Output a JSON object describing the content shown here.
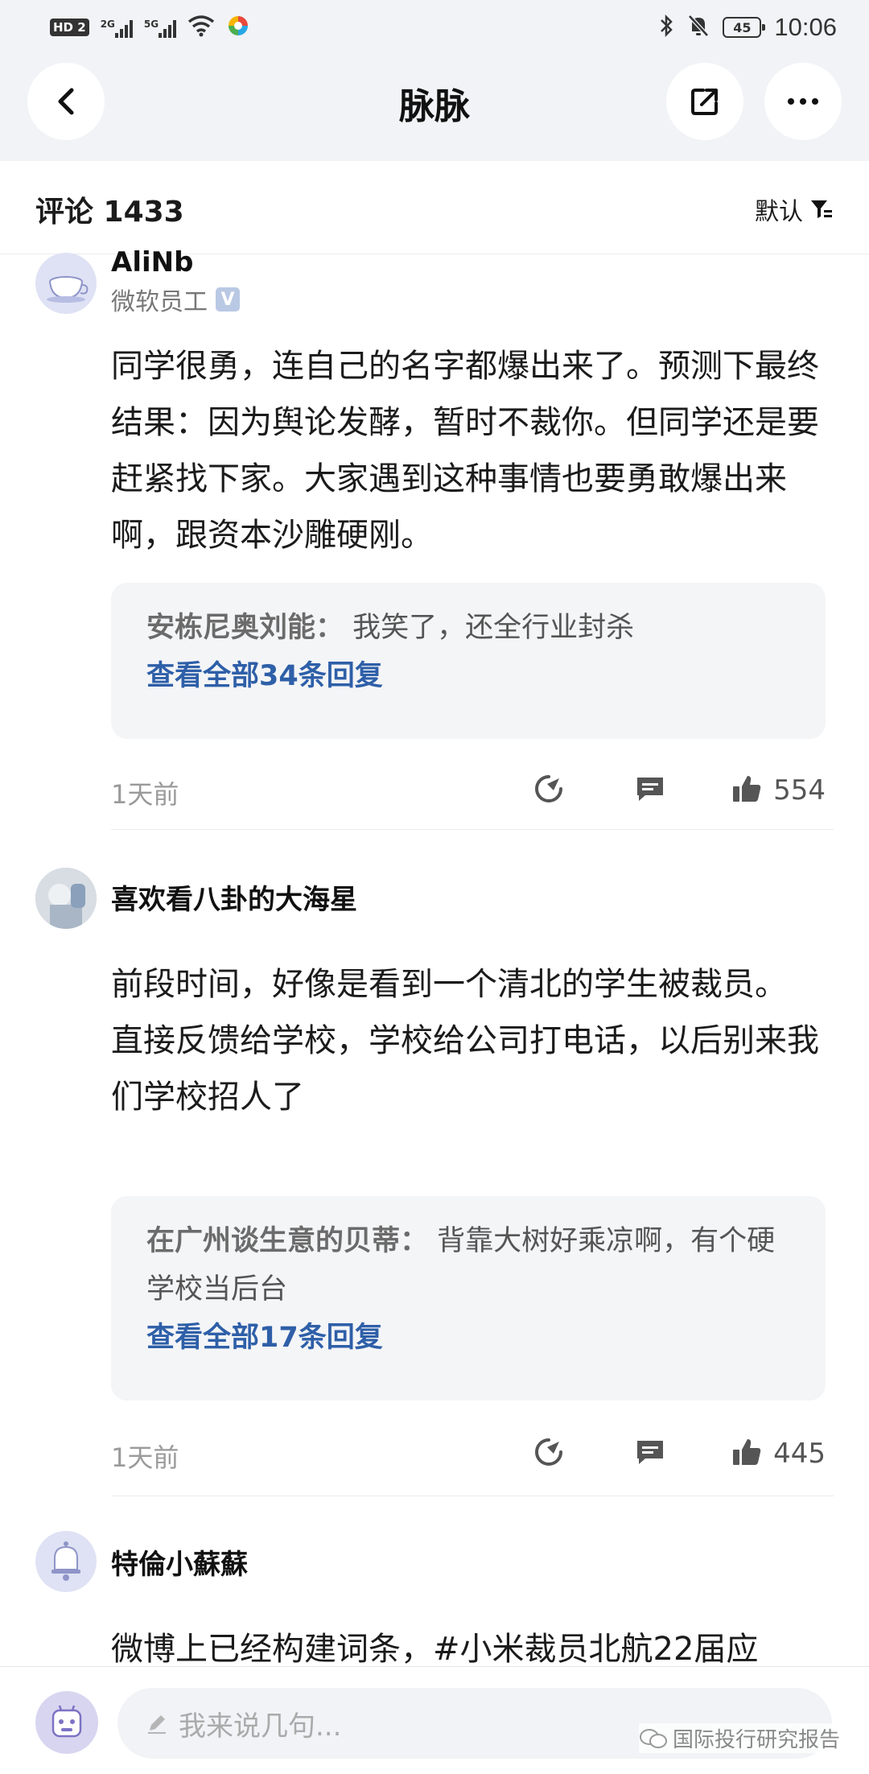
{
  "status_bar": {
    "hd_label": "HD",
    "hd_num": "2",
    "sig1_label": "2G",
    "sig2_label": "5G",
    "battery": "45",
    "time": "10:06"
  },
  "nav": {
    "title": "脉脉"
  },
  "comments_header": {
    "label": "评论 1433",
    "sort_label": "默认"
  },
  "comments": [
    {
      "username": "AliNb",
      "subtitle": "微软员工",
      "badge": "V",
      "text": "同学很勇，连自己的名字都爆出来了。预测下最终结果：因为舆论发酵，暂时不裁你。但同学还是要赶紧找下家。大家遇到这种事情也要勇敢爆出来啊，跟资本沙雕硬刚。",
      "reply_author": "安栋尼奥刘能：",
      "reply_text": "我笑了，还全行业封杀",
      "reply_more": "查看全部34条回复",
      "time": "1天前",
      "likes": "554"
    },
    {
      "username": "喜欢看八卦的大海星",
      "text": "前段时间，好像是看到一个清北的学生被裁员。\n直接反馈给学校，学校给公司打电话，以后别来我们学校招人了",
      "reply_author": "在广州谈生意的贝蒂：",
      "reply_text": "背靠大树好乘凉啊，有个硬学校当后台",
      "reply_more": "查看全部17条回复",
      "time": "1天前",
      "likes": "445"
    },
    {
      "username": "特倫小蘇蘇",
      "text": "微博上已经构建词条，#小米裁员北航22届应"
    }
  ],
  "composer": {
    "placeholder": "我来说几句..."
  },
  "watermark": "国际投行研究报告"
}
